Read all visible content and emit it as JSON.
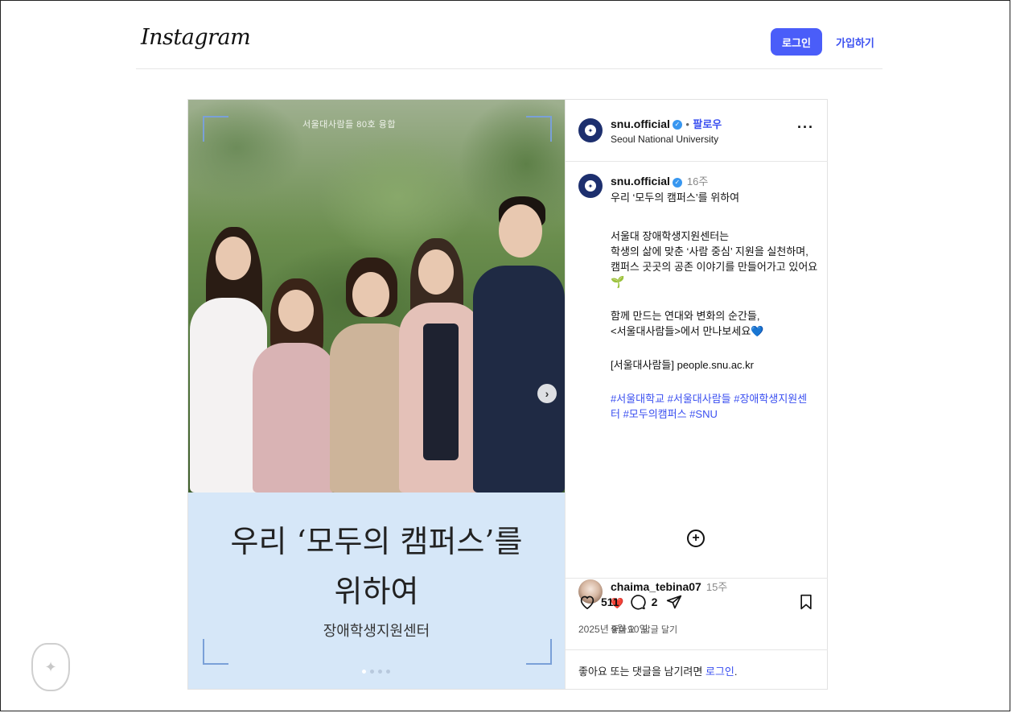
{
  "header": {
    "logo": "Instagram",
    "login_label": "로그인",
    "signup_label": "가입하기"
  },
  "media": {
    "photo_caption": "서울대사람들 80호 융합",
    "title_line1": "우리 ‘모두의 캠퍼스’를",
    "title_line2": "위하여",
    "subtitle": "장애학생지원센터",
    "next_arrow": "›",
    "slide_count": 4,
    "active_slide": 1
  },
  "post_header": {
    "username": "snu.official",
    "follow_label": "팔로우",
    "separator": "•",
    "display_name": "Seoul National University",
    "more_label": "···"
  },
  "caption": {
    "username": "snu.official",
    "time": "16주",
    "lines": [
      "우리 ‘모두의 캠퍼스’를 위하여",
      "서울대 장애학생지원센터는",
      "학생의 삶에 맞춘 ‘사람 중심’ 지원을 실천하며,",
      "캠퍼스 곳곳의 공존 이야기를 만들어가고 있어요",
      "함께 만드는 연대와 변화의 순간들,",
      "<서울대사람들>에서 만나보세요💙",
      "[서울대사람들] people.snu.ac.kr"
    ],
    "hashtags_line1": "#서울대학교 #서울대사람들 #장애학생지원센",
    "hashtags_line2": "터 #모두의캠퍼스 #SNU",
    "load_more_label": "+"
  },
  "comment": {
    "username": "chaima_tebina07",
    "time": "15주",
    "text": "❤️",
    "like_label": "좋아요",
    "reply_label": "답글 달기"
  },
  "actions": {
    "likes": "511",
    "comments": "2",
    "date": "2025년 9월 10일",
    "login_prompt": "좋아요 또는 댓글을 남기려면",
    "login_link": "로그인",
    "login_suffix": "."
  },
  "colors": {
    "accent": "#4a5df9",
    "link": "#3a4ff0",
    "title_panel": "#d6e7f8",
    "avatar": "#1d2f6e"
  }
}
